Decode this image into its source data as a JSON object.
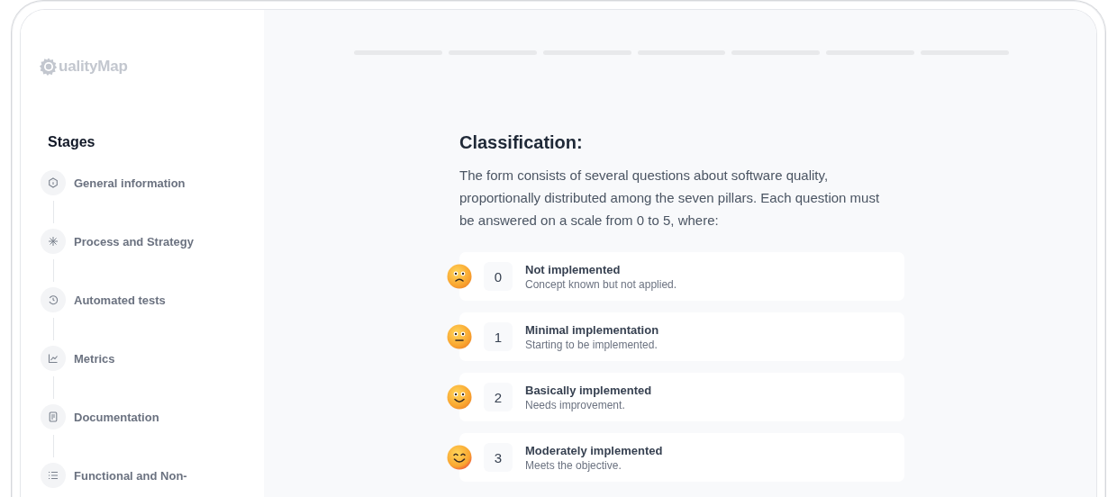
{
  "logo": {
    "text": "ualityMap"
  },
  "sidebar": {
    "title": "Stages",
    "items": [
      {
        "label": "General information",
        "kind": "info",
        "selected": false
      },
      {
        "label": "Process and Strategy",
        "kind": "asterisk",
        "selected": false
      },
      {
        "label": "Automated tests",
        "kind": "history",
        "selected": false
      },
      {
        "label": "Metrics",
        "kind": "chart",
        "selected": false
      },
      {
        "label": "Documentation",
        "kind": "document",
        "selected": false
      },
      {
        "label": "Functional and Non-",
        "kind": "list",
        "selected": false
      }
    ]
  },
  "progress_steps": [
    {
      "done": false
    },
    {
      "done": false
    },
    {
      "done": false
    },
    {
      "done": false
    },
    {
      "done": false
    },
    {
      "done": false
    },
    {
      "done": false
    }
  ],
  "content": {
    "title": "Classification:",
    "description": "The form consists of several questions about software quality, proportionally distributed among the seven pillars. Each question must be answered on a scale from 0 to 5, where:",
    "scale": [
      {
        "kind": "sad",
        "value": "0",
        "title": "Not implemented",
        "subtitle": "Concept known but not applied."
      },
      {
        "kind": "neutral",
        "value": "1",
        "title": "Minimal implementation",
        "subtitle": "Starting to be implemented."
      },
      {
        "kind": "smile",
        "value": "2",
        "title": "Basically implemented",
        "subtitle": "Needs improvement."
      },
      {
        "kind": "blush",
        "value": "3",
        "title": "Moderately implemented",
        "subtitle": "Meets the objective."
      }
    ]
  }
}
